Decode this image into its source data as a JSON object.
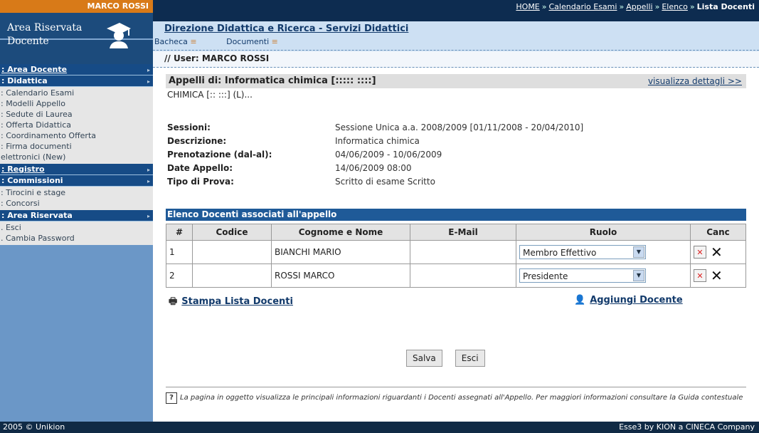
{
  "sidebar": {
    "user_name": "MARCO ROSSI",
    "logo_line1": "Area Riservata",
    "logo_line2": "Docente",
    "sections": [
      {
        "title": ": Area Docente",
        "items": []
      },
      {
        "title": ": Didattica",
        "items": [
          ": Calendario Esami",
          ": Modelli Appello",
          ": Sedute di Laurea",
          ": Offerta Didattica",
          ": Coordinamento Offerta",
          ": Firma documenti",
          "elettronici (New)"
        ]
      },
      {
        "title": ": Registro",
        "items": []
      },
      {
        "title": ": Commissioni",
        "items": [
          ": Tirocini e stage",
          ": Concorsi"
        ]
      },
      {
        "title": ": Area Riservata",
        "items": [
          ". Esci",
          ". Cambia Password"
        ]
      }
    ],
    "footer": "2005 © Unikion"
  },
  "breadcrumb": {
    "items": [
      "HOME",
      "Calendario Esami",
      "Appelli",
      "Elenco"
    ],
    "separator": "»",
    "current": "Lista Docenti"
  },
  "header": {
    "title": "Direzione Didattica e Ricerca - Servizi Didattici",
    "tabs": [
      "Bacheca",
      "Documenti"
    ]
  },
  "user_line": "// User: MARCO ROSSI",
  "main": {
    "appelli_title": "Appelli di: Informatica chimica [::::: ::::]",
    "details_link": "visualizza dettagli >>",
    "course_line": "CHIMICA [:: :::] (L)...",
    "info": [
      {
        "label": "Sessioni:",
        "value": "Sessione Unica a.a. 2008/2009 [01/11/2008 - 20/04/2010]"
      },
      {
        "label": "Descrizione:",
        "value": "Informatica chimica"
      },
      {
        "label": "Prenotazione (dal-al):",
        "value": "04/06/2009 - 10/06/2009"
      },
      {
        "label": "Date Appello:",
        "value": "14/06/2009 08:00"
      },
      {
        "label": "Tipo di Prova:",
        "value": "Scritto di esame Scritto"
      }
    ],
    "list_title": "Elenco Docenti associati all'appello",
    "table": {
      "headers": [
        "#",
        "Codice",
        "Cognome e Nome",
        "E-Mail",
        "Ruolo",
        "Canc"
      ],
      "rows": [
        {
          "num": "1",
          "codice": "",
          "nome": "BIANCHI MARIO",
          "email": "",
          "ruolo": "Membro Effettivo"
        },
        {
          "num": "2",
          "codice": "",
          "nome": "ROSSI MARCO",
          "email": "",
          "ruolo": "Presidente"
        }
      ]
    },
    "print_link": "Stampa Lista Docenti",
    "add_link": "Aggiungi Docente",
    "save_button": "Salva",
    "exit_button": "Esci",
    "note": "La pagina in oggetto visualizza le principali informazioni riguardanti i Docenti assegnati all'Appello. Per maggiori informazioni consultare la Guida contestuale"
  },
  "footer_right": "Esse3 by KION a CINECA Company",
  "colors": {
    "accent": "#d87a18",
    "navy": "#0d2c50",
    "sidebar": "#6b97c7",
    "list_header": "#1f5a98"
  }
}
